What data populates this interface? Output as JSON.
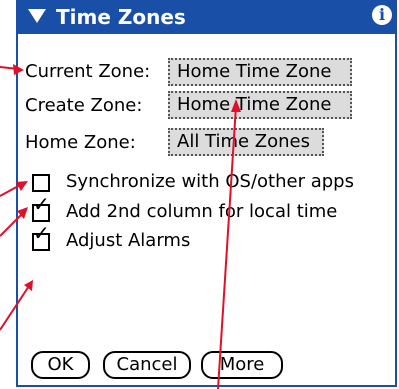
{
  "titlebar": {
    "title": "Time Zones",
    "menu_icon": "triangle-down-icon",
    "info_icon": "info-icon",
    "info_glyph": "i"
  },
  "fields": [
    {
      "label": "Current Zone:",
      "value": "Home Time Zone"
    },
    {
      "label": "Create Zone:",
      "value": "Home Time Zone"
    },
    {
      "label": "Home Zone:",
      "value": "All Time Zones"
    }
  ],
  "options": [
    {
      "label": "Synchronize with OS/other apps",
      "checked": false,
      "mark": ""
    },
    {
      "label": "Add 2nd column for local time",
      "checked": true,
      "mark": "✓"
    },
    {
      "label": "Adjust Alarms",
      "checked": true,
      "mark": "✓"
    }
  ],
  "buttons": {
    "ok": "OK",
    "cancel": "Cancel",
    "more": "More"
  },
  "colors": {
    "titlebar": "#1a4fa8",
    "callout_arrows": "#e0102a",
    "select_bg": "#dcdcdc"
  }
}
